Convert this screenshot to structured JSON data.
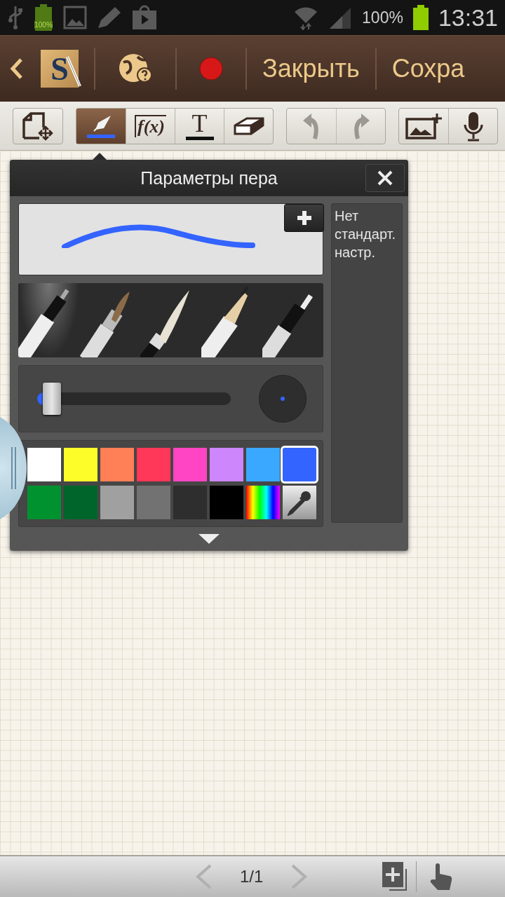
{
  "status_bar": {
    "battery_small_text": "100%",
    "battery": "100%",
    "time": "13:31"
  },
  "action_bar": {
    "logo_text": "S",
    "buttons": [
      "Закрыть",
      "Сохра"
    ]
  },
  "toolbar": {
    "groups": [
      {
        "tools": [
          {
            "kind": "insert-page"
          }
        ]
      },
      {
        "tools": [
          {
            "kind": "pen",
            "selected": true
          },
          {
            "kind": "formula",
            "label": "f(x)",
            "selected": false
          },
          {
            "kind": "text",
            "label": "T",
            "selected": false
          },
          {
            "kind": "eraser",
            "selected": false
          }
        ]
      },
      {
        "tools": [
          {
            "kind": "undo",
            "disabled": true
          },
          {
            "kind": "redo",
            "disabled": true
          }
        ]
      },
      {
        "tools": [
          {
            "kind": "image"
          },
          {
            "kind": "voice"
          }
        ]
      }
    ]
  },
  "pen_panel": {
    "title": "Параметры пера",
    "preset_note": "Нет стандарт. настр.",
    "pens": [
      {
        "kind": "fountain",
        "selected": true
      },
      {
        "kind": "brush",
        "selected": false
      },
      {
        "kind": "calligraphy",
        "selected": false
      },
      {
        "kind": "pencil",
        "selected": false
      },
      {
        "kind": "marker",
        "selected": false
      }
    ],
    "size": {
      "level": 0.05
    },
    "colors": [
      {
        "kind": "swatch",
        "color": "#ffffff",
        "selected": false
      },
      {
        "kind": "swatch",
        "color": "#fdfd2a",
        "selected": false
      },
      {
        "kind": "swatch",
        "color": "#ff7f57",
        "selected": false
      },
      {
        "kind": "swatch",
        "color": "#ff3759",
        "selected": false
      },
      {
        "kind": "swatch",
        "color": "#ff45c3",
        "selected": false
      },
      {
        "kind": "swatch",
        "color": "#cd86fb",
        "selected": false
      },
      {
        "kind": "swatch",
        "color": "#3aa8ff",
        "selected": false
      },
      {
        "kind": "swatch",
        "color": "#3464ff",
        "selected": true
      },
      {
        "kind": "swatch",
        "color": "#00922f",
        "selected": false
      },
      {
        "kind": "swatch",
        "color": "#00652a",
        "selected": false
      },
      {
        "kind": "swatch",
        "color": "#a0a0a0",
        "selected": false
      },
      {
        "kind": "swatch",
        "color": "#727272",
        "selected": false
      },
      {
        "kind": "swatch",
        "color": "#2e2e2e",
        "selected": false
      },
      {
        "kind": "swatch",
        "color": "#000000",
        "selected": false
      },
      {
        "kind": "spectrum",
        "selected": false
      },
      {
        "kind": "picker",
        "selected": false
      }
    ]
  },
  "page_nav": {
    "page": "1/1"
  }
}
